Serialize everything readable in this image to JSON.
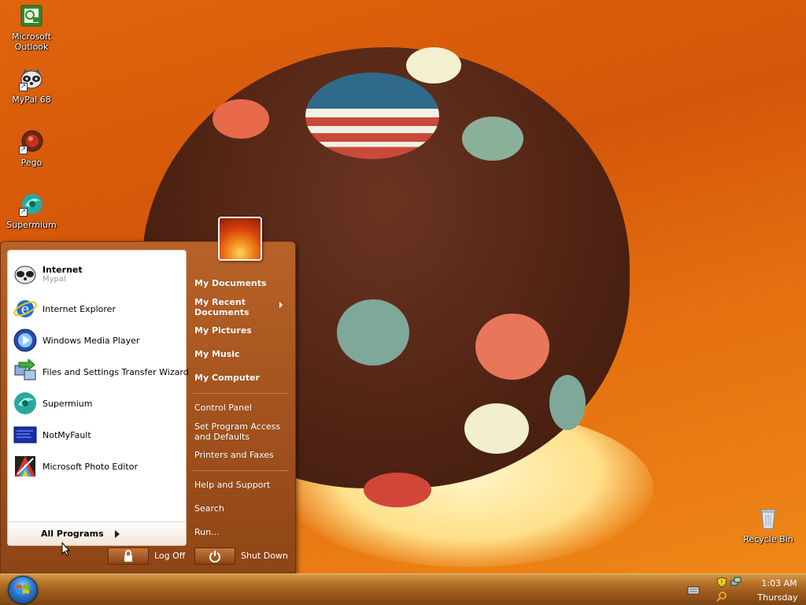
{
  "desktop": {
    "icons": [
      {
        "label": "Microsoft Outlook"
      },
      {
        "label": "MyPal 68"
      },
      {
        "label": "Pego"
      },
      {
        "label": "Supermium"
      },
      {
        "label": "Recycle Bin"
      }
    ]
  },
  "start_menu": {
    "pinned": [
      {
        "title": "Internet",
        "subtitle": "Mypal",
        "icon": "mypal-raccoon-icon"
      },
      {
        "title": "Internet Explorer",
        "icon": "internet-explorer-icon"
      },
      {
        "title": "Windows Media Player",
        "icon": "media-player-icon"
      },
      {
        "title": "Files and Settings Transfer Wizard",
        "icon": "transfer-wizard-icon"
      },
      {
        "title": "Supermium",
        "icon": "supermium-icon"
      },
      {
        "title": "NotMyFault",
        "icon": "notmyfault-icon"
      },
      {
        "title": "Microsoft Photo Editor",
        "icon": "photo-editor-icon"
      }
    ],
    "all_programs": "All Programs",
    "right": {
      "my_documents": "My Documents",
      "my_recent_documents": "My Recent Documents",
      "my_pictures": "My Pictures",
      "my_music": "My Music",
      "my_computer": "My Computer",
      "control_panel": "Control Panel",
      "set_program_access": "Set Program Access and Defaults",
      "printers": "Printers and Faxes",
      "help": "Help and Support",
      "search": "Search",
      "run": "Run..."
    },
    "log_off": "Log Off",
    "shut_down": "Shut Down"
  },
  "taskbar": {
    "clock": {
      "time": "1:03 AM",
      "day": "Thursday"
    }
  },
  "colors": {
    "menu_orange": "#a4531e",
    "taskbar": "#9a5a1c",
    "start_orb": "#2a78c8"
  }
}
